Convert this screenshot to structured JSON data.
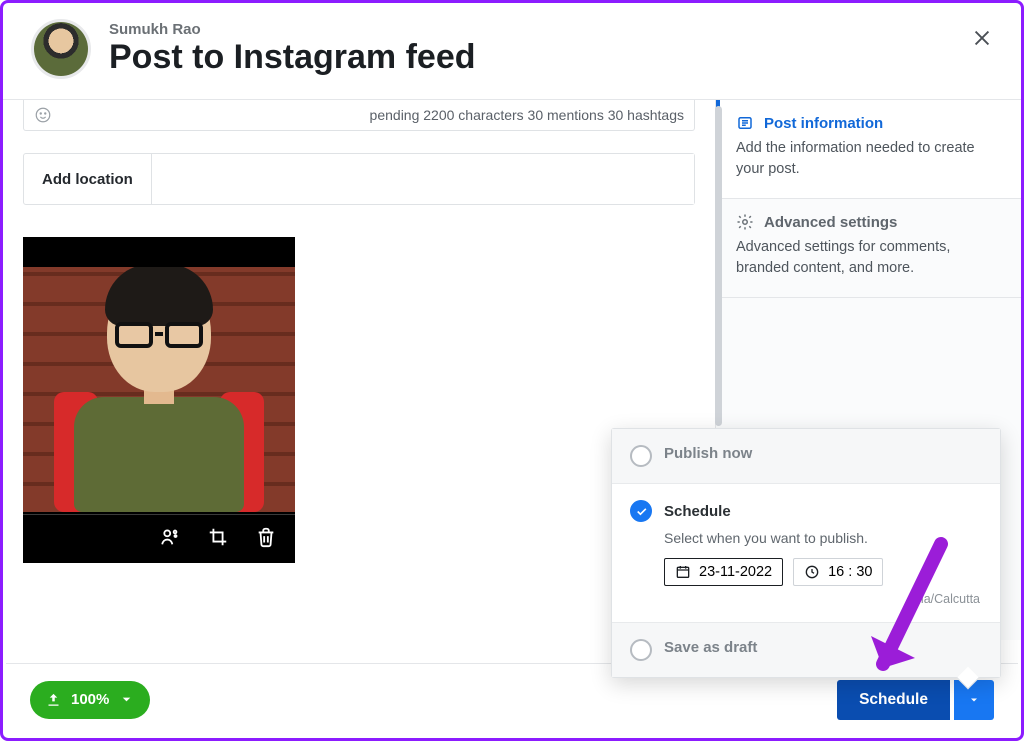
{
  "user_name": "Sumukh Rao",
  "page_title": "Post to Instagram feed",
  "caption_status": "pending 2200 characters 30 mentions 30 hashtags",
  "location_label": "Add location",
  "right_panel": {
    "post_info": {
      "title": "Post information",
      "desc": "Add the information needed to create your post."
    },
    "advanced": {
      "title": "Advanced settings",
      "desc": "Advanced settings for comments, branded content, and more."
    }
  },
  "popover": {
    "publish_now": "Publish now",
    "schedule": "Schedule",
    "schedule_sub": "Select when you want to publish.",
    "date": "23-11-2022",
    "time": "16 : 30",
    "timezone": "Asia/Calcutta",
    "save_draft": "Save as draft"
  },
  "footer": {
    "upload_pct": "100%",
    "schedule_btn": "Schedule"
  }
}
